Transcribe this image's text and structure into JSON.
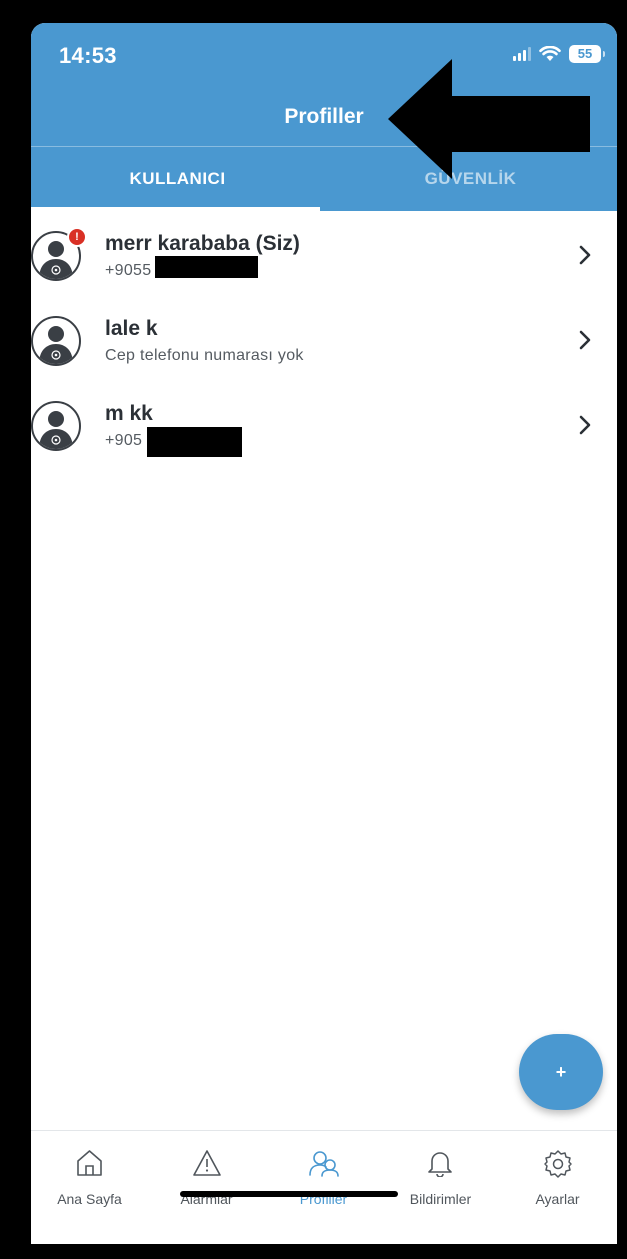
{
  "status_bar": {
    "time": "14:53",
    "battery": "55"
  },
  "header": {
    "title": "Profiller"
  },
  "tabs": [
    {
      "label": "KULLANICI",
      "active": true
    },
    {
      "label": "GÜVENLİK",
      "active": false
    }
  ],
  "profiles": [
    {
      "name": "merr karababa (Siz)",
      "detail": "+9055",
      "has_alert": true,
      "badge": "!"
    },
    {
      "name": "lale k",
      "detail": "Cep telefonu numarası yok",
      "has_alert": false
    },
    {
      "name": "m kk",
      "detail": "+905",
      "has_alert": false
    }
  ],
  "fab": {
    "label": "+"
  },
  "bottom_nav": [
    {
      "label": "Ana Sayfa",
      "icon": "home-icon",
      "active": false
    },
    {
      "label": "Alarmlar",
      "icon": "warning-icon",
      "active": false
    },
    {
      "label": "Profiller",
      "icon": "profiles-icon",
      "active": true
    },
    {
      "label": "Bildirimler",
      "icon": "bell-icon",
      "active": false
    },
    {
      "label": "Ayarlar",
      "icon": "gear-icon",
      "active": false
    }
  ],
  "colors": {
    "primary": "#4a98d0",
    "alert": "#d93025",
    "text": "#2b3036"
  }
}
